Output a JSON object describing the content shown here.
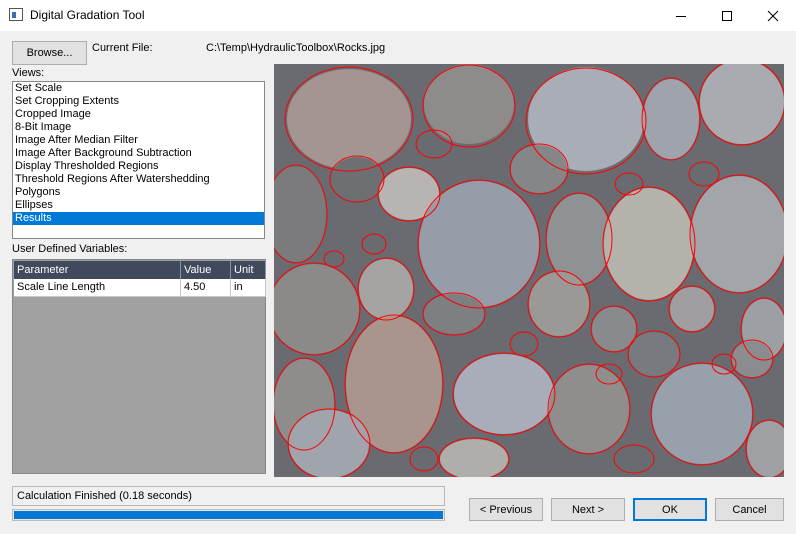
{
  "window": {
    "title": "Digital Gradation Tool",
    "controls": [
      "minimize-icon",
      "maximize-icon",
      "close-icon"
    ]
  },
  "file": {
    "browse_label": "Browse...",
    "current_file_label": "Current File:",
    "current_file_path": "C:\\Temp\\HydraulicToolbox\\Rocks.jpg"
  },
  "views": {
    "label": "Views:",
    "items": [
      "Set Scale",
      "Set Cropping Extents",
      "Cropped Image",
      "8-Bit Image",
      "Image After Median Filter",
      "Image After Background Subtraction",
      "Display Thresholded Regions",
      "Threshold Regions After Watershedding",
      "Polygons",
      "Ellipses",
      "Results"
    ],
    "selected": "Results"
  },
  "variables": {
    "label": "User Defined Variables:",
    "columns": [
      "Parameter",
      "Value",
      "Unit"
    ],
    "rows": [
      {
        "parameter": "Scale Line Length",
        "value": "4.50",
        "unit": "in"
      }
    ]
  },
  "status": {
    "text": "Calculation Finished (0.18 seconds)",
    "progress_percent": 100
  },
  "buttons": {
    "previous": "< Previous",
    "next": "Next >",
    "ok": "OK",
    "cancel": "Cancel"
  },
  "colors": {
    "selection": "#0078d7",
    "ellipse_outline": "#ff0000",
    "progress": "#0678d4",
    "grid_header": "#404a5c"
  }
}
